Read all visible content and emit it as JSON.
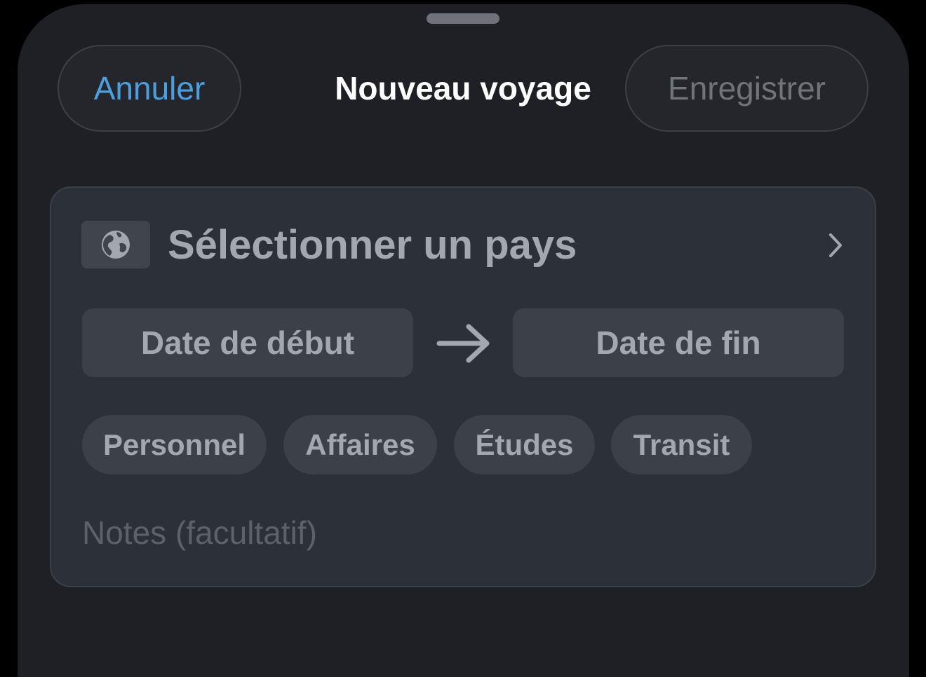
{
  "header": {
    "cancel_label": "Annuler",
    "title": "Nouveau voyage",
    "save_label": "Enregistrer"
  },
  "form": {
    "country": {
      "icon": "globe-icon",
      "label": "Sélectionner un pays",
      "chevron_icon": "chevron-right-icon"
    },
    "dates": {
      "start_label": "Date de début",
      "arrow_icon": "arrow-right-icon",
      "end_label": "Date de fin"
    },
    "trip_types": [
      {
        "label": "Personnel"
      },
      {
        "label": "Affaires"
      },
      {
        "label": "Études"
      },
      {
        "label": "Transit"
      }
    ],
    "notes": {
      "placeholder": "Notes (facultatif)",
      "value": ""
    }
  },
  "colors": {
    "accent": "#4a9fe0",
    "background": "#1e2025",
    "card": "#2c3038",
    "chip": "#3c4048",
    "muted_text": "#a3a7ae",
    "disabled_text": "#6f737a"
  }
}
